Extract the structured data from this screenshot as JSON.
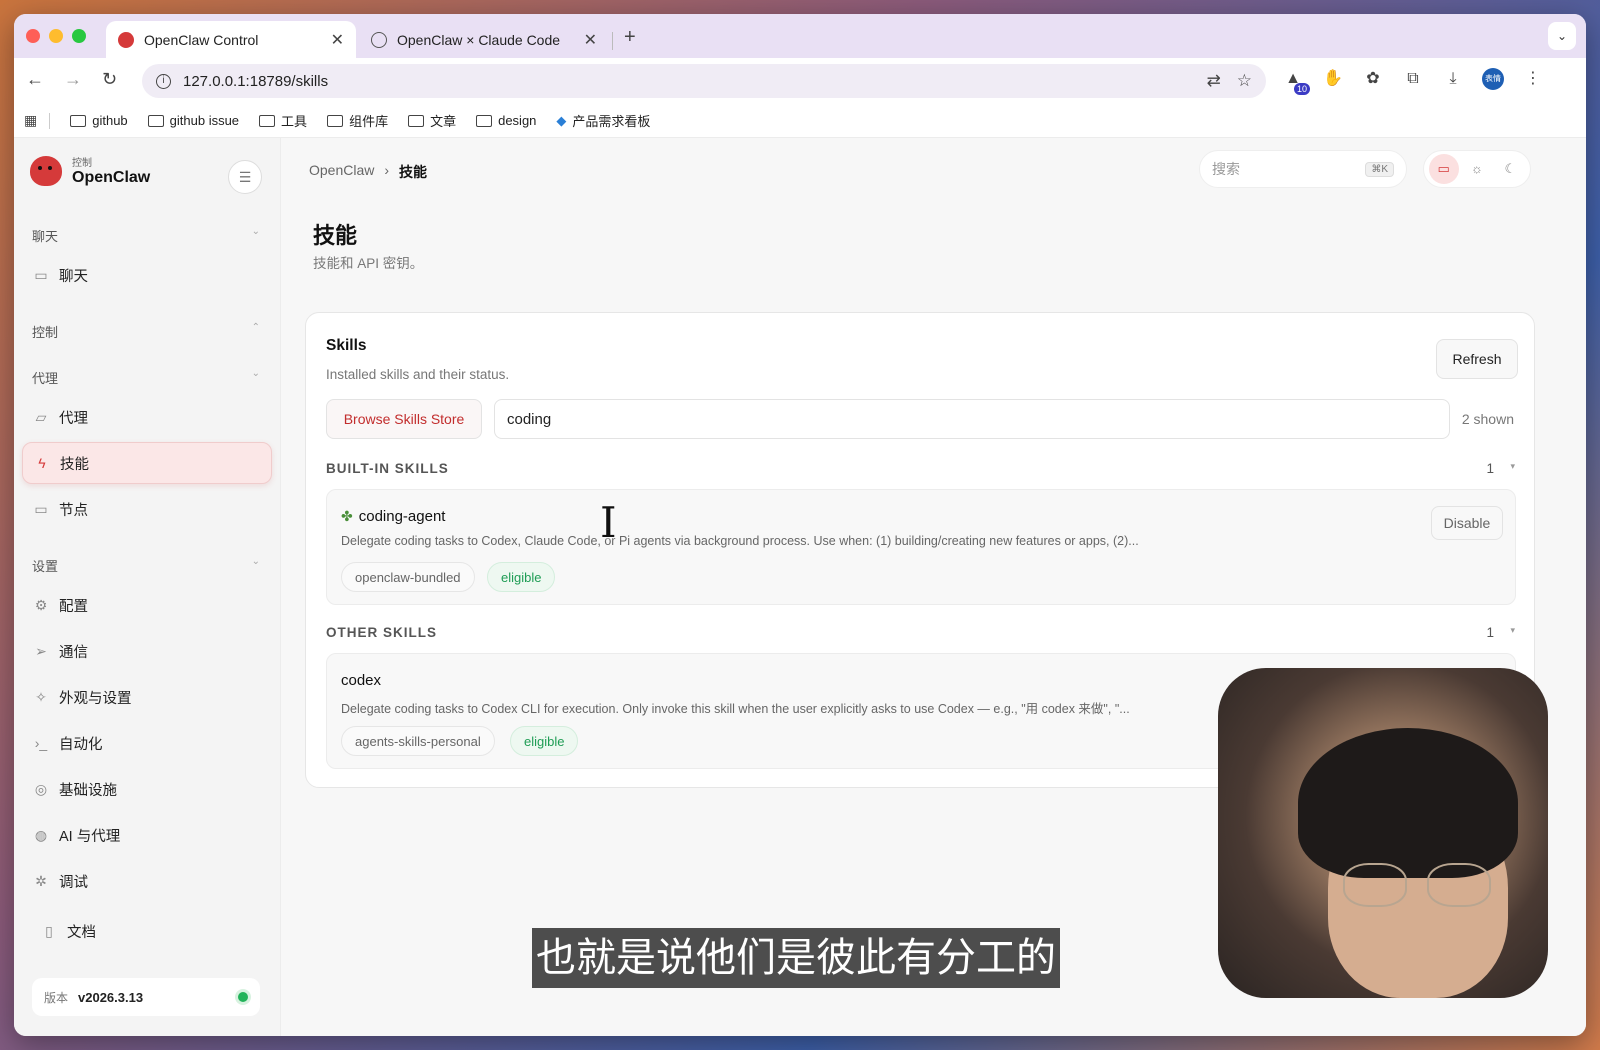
{
  "browser": {
    "tabs": [
      {
        "title": "OpenClaw Control",
        "active": true
      },
      {
        "title": "OpenClaw × Claude Code",
        "active": false
      }
    ],
    "url": "127.0.0.1:18789/skills",
    "extension_badge": "10",
    "profile_label": "表情",
    "bookmarks": [
      "github",
      "github issue",
      "工具",
      "组件库",
      "文章",
      "design",
      "产品需求看板"
    ]
  },
  "sidebar": {
    "brand_small": "控制",
    "brand_name": "OpenClaw",
    "sections": {
      "chat": "聊天",
      "control": "控制",
      "agent": "代理",
      "settings": "设置"
    },
    "items": {
      "chat": "聊天",
      "agents": "代理",
      "skills": "技能",
      "nodes": "节点",
      "config": "配置",
      "comms": "通信",
      "appearance": "外观与设置",
      "automation": "自动化",
      "infra": "基础设施",
      "ai": "AI 与代理",
      "debug": "调试",
      "docs": "文档"
    },
    "version_label": "版本",
    "version_value": "v2026.3.13"
  },
  "header": {
    "breadcrumb_root": "OpenClaw",
    "breadcrumb_current": "技能",
    "search_placeholder": "搜索",
    "search_kbd": "⌘K"
  },
  "page": {
    "title": "技能",
    "subtitle": "技能和 API 密钥。"
  },
  "card": {
    "title": "Skills",
    "subtitle": "Installed skills and their status.",
    "refresh_label": "Refresh",
    "store_label": "Browse Skills Store",
    "filter_value": "coding",
    "shown": "2 shown",
    "groups": [
      {
        "heading": "BUILT-IN SKILLS",
        "count": "1",
        "skill": {
          "name": "coding-agent",
          "description": "Delegate coding tasks to Codex, Claude Code, or Pi agents via background process. Use when: (1) building/creating new features or apps, (2)...",
          "source": "openclaw-bundled",
          "status": "eligible",
          "action": "Disable"
        }
      },
      {
        "heading": "OTHER SKILLS",
        "count": "1",
        "skill": {
          "name": "codex",
          "description": "Delegate coding tasks to Codex CLI for execution. Only invoke this skill when the user explicitly asks to use Codex — e.g., \"用 codex 来做\", \"...",
          "source": "agents-skills-personal",
          "status": "eligible"
        }
      }
    ]
  },
  "overlay": {
    "subtitle": "也就是说他们是彼此有分工的"
  }
}
